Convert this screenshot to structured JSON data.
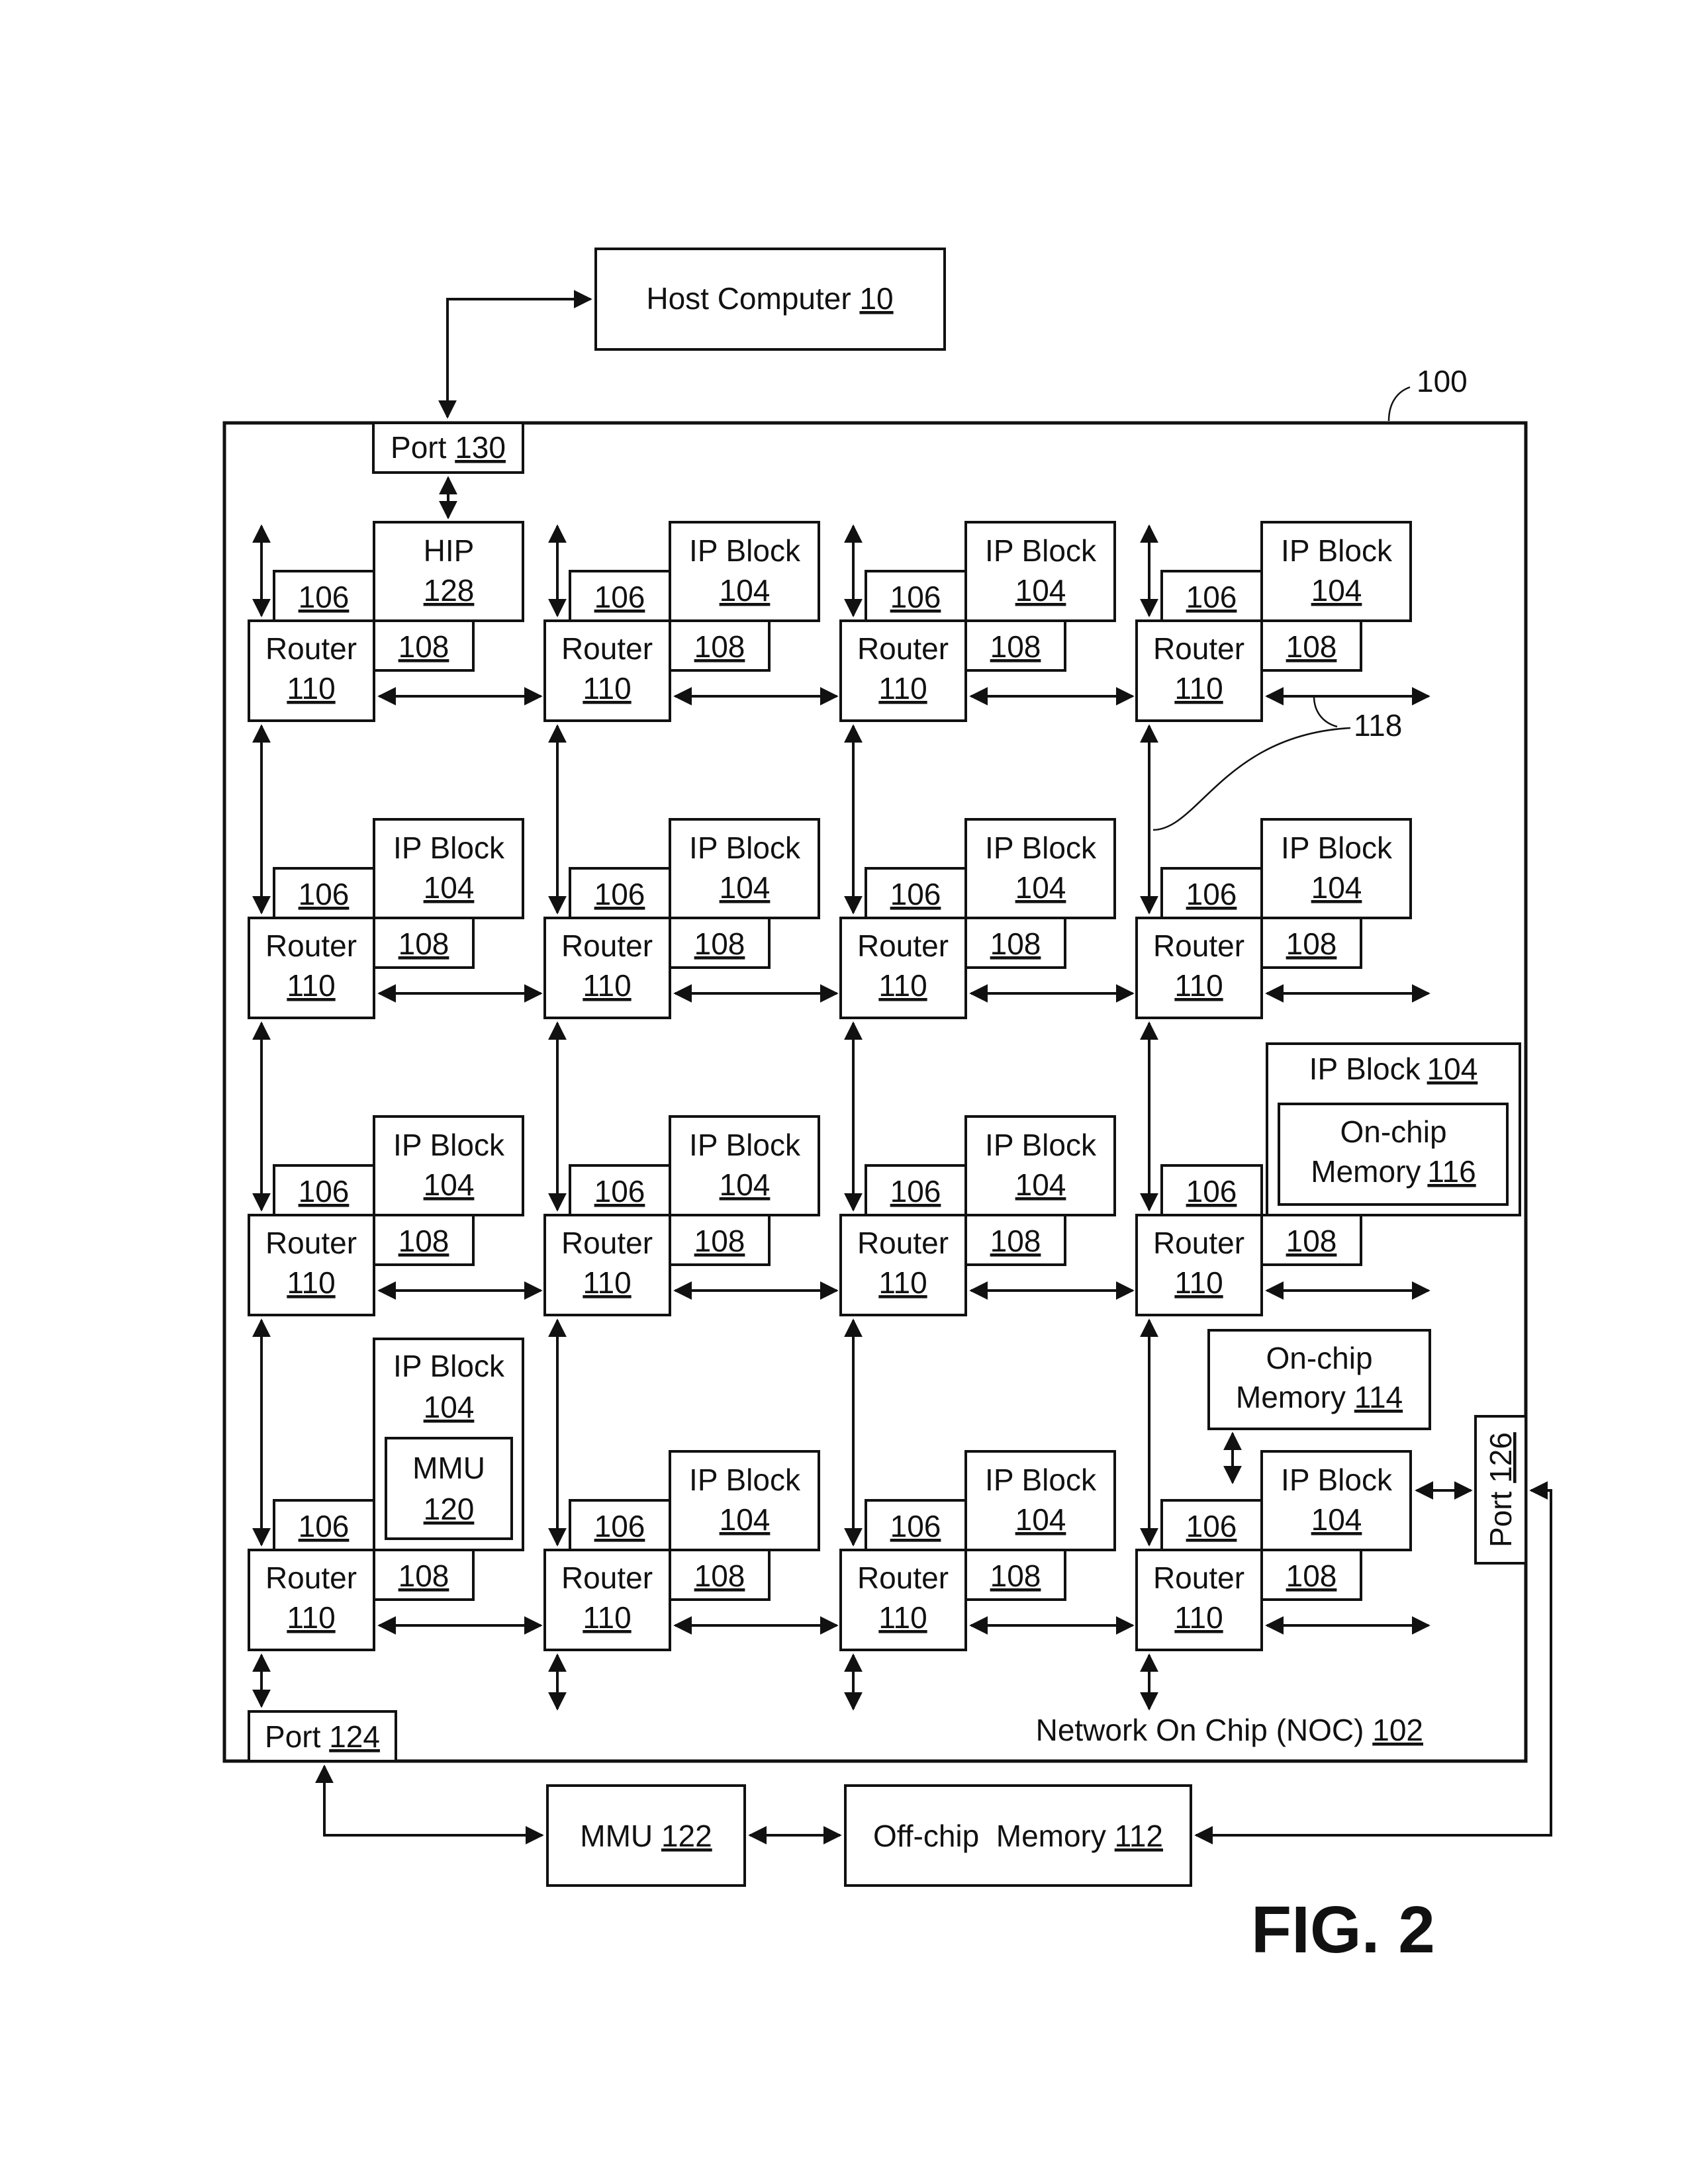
{
  "figure": {
    "label": "FIG. 2",
    "ref_system": "100"
  },
  "host": {
    "name": "Host Computer",
    "ref": "10"
  },
  "noc": {
    "name": "Network On Chip (NOC)",
    "ref": "102"
  },
  "ports": {
    "port130": {
      "name": "Port",
      "ref": "130"
    },
    "port124": {
      "name": "Port",
      "ref": "124"
    },
    "port126": {
      "name": "Port",
      "ref": "126"
    }
  },
  "external": {
    "mmu122": {
      "name": "MMU",
      "ref": "122"
    },
    "offchip112": {
      "name": "Off-chip  Memory",
      "ref": "112"
    }
  },
  "grid": {
    "router": {
      "name": "Router",
      "ref": "110"
    },
    "ni106": {
      "ref": "106"
    },
    "mc108": {
      "ref": "108"
    },
    "ipblock": {
      "name": "IP Block",
      "ref": "104"
    },
    "hip": {
      "name": "HIP",
      "ref": "128"
    },
    "mmu120": {
      "name": "MMU",
      "ref": "120"
    },
    "mem116": {
      "line1": "On-chip",
      "line2": "Memory",
      "ref": "116"
    },
    "mem114": {
      "line1": "On-chip",
      "line2": "Memory",
      "ref": "114"
    },
    "link_ref": "118"
  }
}
